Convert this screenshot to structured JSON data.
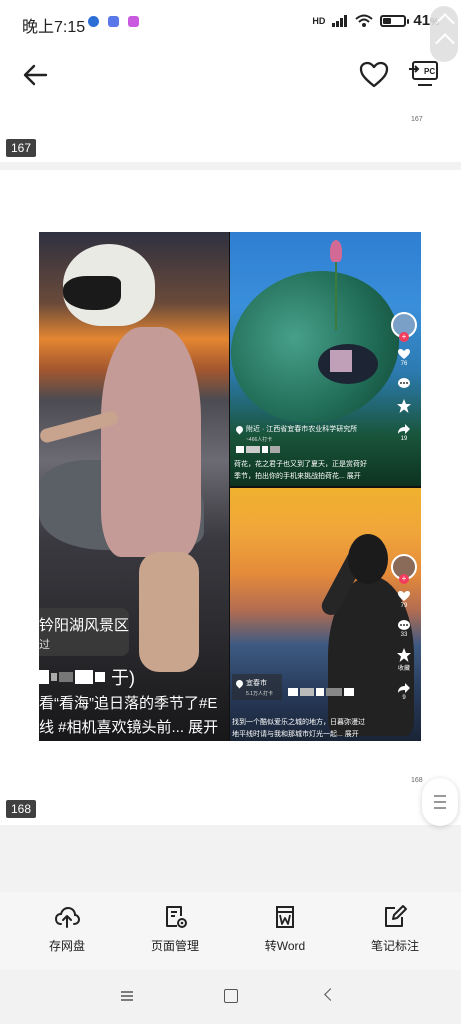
{
  "status_bar": {
    "time": "晚上7:15",
    "network": "HD",
    "battery_percent": "41",
    "battery_symbol": "%",
    "battery_level": 0.41,
    "notification_colors": [
      "#2b6fd6",
      "#5a79e8",
      "#c95ae0"
    ]
  },
  "top_nav": {
    "back_icon": "arrow-left-icon",
    "favorite_icon": "heart-outline-icon",
    "pc_icon": "cast-to-pc-icon",
    "pc_label": "PC"
  },
  "pages": [
    {
      "number": "167",
      "small_label": "167"
    },
    {
      "number": "168",
      "small_label": "168"
    }
  ],
  "collage": {
    "left_panel": {
      "location": "钤阳湖风景区",
      "location_sub": "过",
      "caption_extra": "于)",
      "caption_line1": "看“看海”追日落的季节了#E",
      "caption_line2": "线 #相机喜欢镜头前... 展开"
    },
    "right_top_panel": {
      "location": "附近 · 江西省宜春市农业科学研究所",
      "visitors": "~466人打卡",
      "caption_line1": "荷花，花之君子也又到了夏天，正是赏荷好",
      "caption_line2": "季节，拍出你的手机来挑战拍荷花... 展开",
      "counts": [
        "76",
        "19"
      ]
    },
    "right_bottom_panel": {
      "location": "宜春市",
      "visitors": "5.1万人打卡",
      "caption_line1": "找到一个酷似爱乐之城的地方，日暮弥漫过",
      "caption_line2": "地平线时请与我和那城市灯光一起... 展开",
      "counts": [
        "79",
        "33",
        "收藏",
        "9"
      ]
    }
  },
  "toolbar": {
    "items": [
      {
        "label": "存网盘",
        "icon": "cloud-upload-icon"
      },
      {
        "label": "页面管理",
        "icon": "page-manage-icon"
      },
      {
        "label": "转Word",
        "icon": "word-convert-icon"
      },
      {
        "label": "笔记标注",
        "icon": "note-edit-icon"
      }
    ]
  },
  "system_nav": {
    "menu_icon": "menu-icon",
    "home_icon": "home-square-icon",
    "back_icon": "back-chevron-icon"
  },
  "colors": {
    "accent_red": "#f23e5c",
    "badge_bg": "#404040",
    "toolbar_bg": "#f6f6f6"
  }
}
